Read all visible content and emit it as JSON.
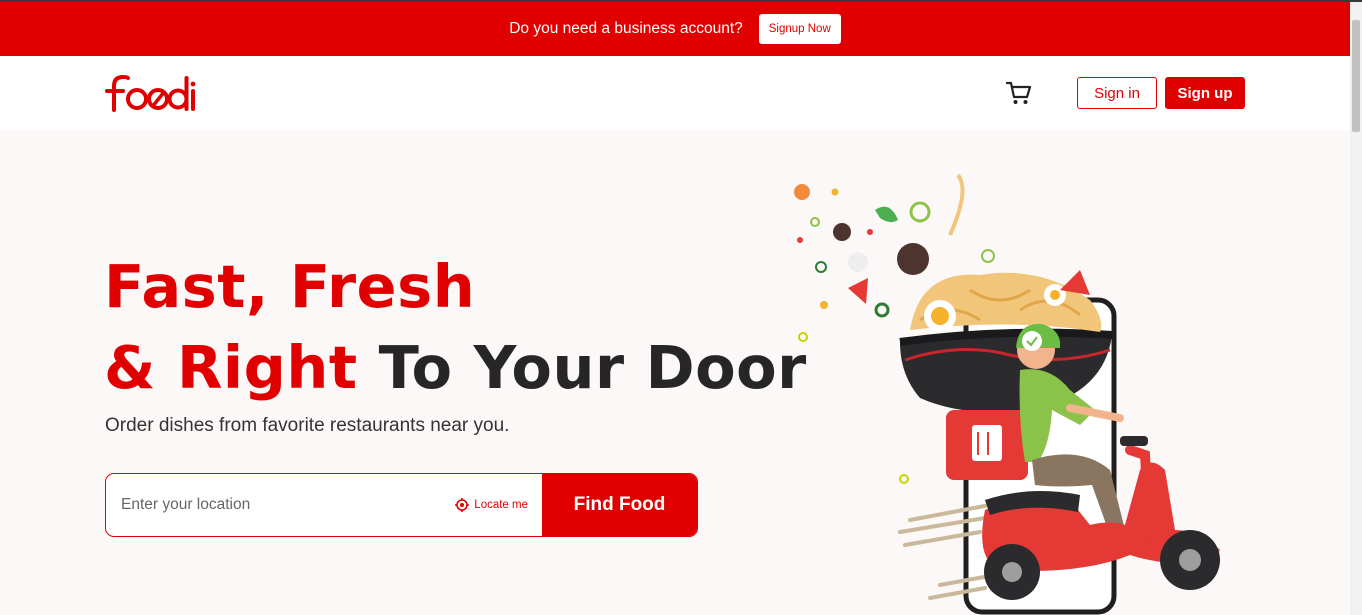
{
  "promo": {
    "text": "Do you need a business account?",
    "button_label": "Signup Now"
  },
  "navbar": {
    "logo_text": "foodi",
    "cart_icon": "cart-icon",
    "signin_label": "Sign in",
    "signup_label": "Sign up"
  },
  "hero": {
    "headline_line1": "Fast, Fresh",
    "headline_line2_accent": "& Right",
    "headline_line2_rest": " To Your Door",
    "subtitle": "Order dishes from favorite restaurants near you.",
    "search": {
      "placeholder": "Enter your location",
      "value": "",
      "locate_label": "Locate me",
      "locate_icon": "target-icon",
      "find_label": "Find Food"
    }
  },
  "colors": {
    "brand_red": "#e10000",
    "hero_bg": "#fcf8f7",
    "text_dark": "#262626"
  }
}
